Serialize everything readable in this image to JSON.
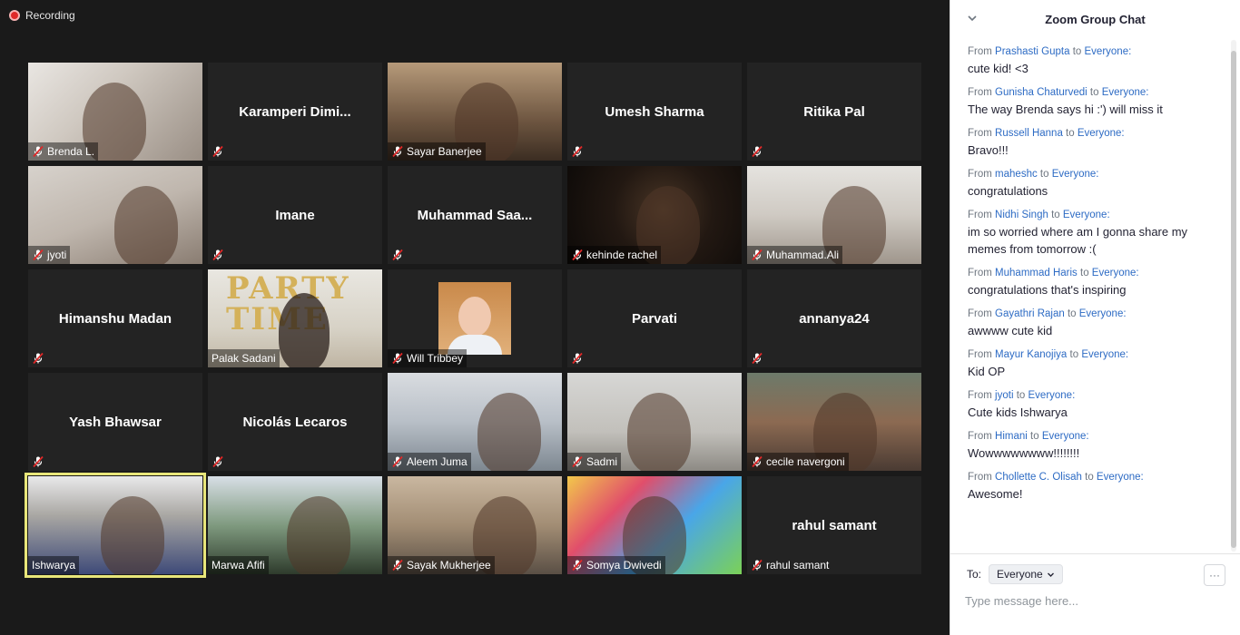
{
  "recording": {
    "label": "Recording"
  },
  "participants": [
    {
      "name": "Brenda L.",
      "video": true
    },
    {
      "name": "Karamperi  Dimi...",
      "video": false
    },
    {
      "name": "Sayar Banerjee",
      "video": true
    },
    {
      "name": "Umesh Sharma",
      "video": false
    },
    {
      "name": "Ritika Pal",
      "video": false
    },
    {
      "name": "jyoti",
      "video": true
    },
    {
      "name": "Imane",
      "video": false
    },
    {
      "name": "Muhammad  Saa...",
      "video": false
    },
    {
      "name": "kehinde rachel",
      "video": true
    },
    {
      "name": "Muhammad.Ali",
      "video": true
    },
    {
      "name": "Himanshu Madan",
      "video": false
    },
    {
      "name": "Palak Sadani",
      "video": true,
      "party_text": "PARTY TIME"
    },
    {
      "name": "Will Tribbey",
      "video": true
    },
    {
      "name": "Parvati",
      "video": false
    },
    {
      "name": "annanya24",
      "video": false
    },
    {
      "name": "Yash Bhawsar",
      "video": false
    },
    {
      "name": "Nicolás Lecaros",
      "video": false
    },
    {
      "name": "Aleem Juma",
      "video": true
    },
    {
      "name": "Sadmi",
      "video": true
    },
    {
      "name": "cecile navergoni",
      "video": true
    },
    {
      "name": "Ishwarya",
      "video": true,
      "active": true
    },
    {
      "name": "Marwa Afifi",
      "video": true
    },
    {
      "name": "Sayak Mukherjee",
      "video": true
    },
    {
      "name": "Somya Dwivedi",
      "video": true
    },
    {
      "name": "rahul samant",
      "video": false
    }
  ],
  "chat": {
    "title": "Zoom Group Chat",
    "from_word": "From",
    "to_word": "to",
    "messages": [
      {
        "from": "Prashasti Gupta",
        "to": "Everyone:",
        "text": "cute kid! <3"
      },
      {
        "from": "Gunisha Chaturvedi",
        "to": "Everyone:",
        "text": "The way Brenda says hi :') will miss it"
      },
      {
        "from": "Russell Hanna",
        "to": "Everyone:",
        "text": "Bravo!!!"
      },
      {
        "from": "maheshc",
        "to": "Everyone:",
        "text": "congratulations"
      },
      {
        "from": "Nidhi Singh",
        "to": "Everyone:",
        "text": "im so worried where am I gonna share my memes from tomorrow :("
      },
      {
        "from": "Muhammad Haris",
        "to": "Everyone:",
        "text": "congratulations that's inspiring"
      },
      {
        "from": "Gayathri Rajan",
        "to": "Everyone:",
        "text": "awwww cute kid"
      },
      {
        "from": "Mayur Kanojiya",
        "to": "Everyone:",
        "text": "Kid OP"
      },
      {
        "from": "jyoti",
        "to": "Everyone:",
        "text": "Cute kids Ishwarya"
      },
      {
        "from": "Himani",
        "to": "Everyone:",
        "text": "Wowwwwwwww!!!!!!!!"
      },
      {
        "from": "Chollette C. Olisah",
        "to": "Everyone:",
        "text": "Awesome!"
      }
    ],
    "to_label": "To:",
    "recipient": "Everyone",
    "input_placeholder": "Type message here...",
    "more_label": "···"
  }
}
